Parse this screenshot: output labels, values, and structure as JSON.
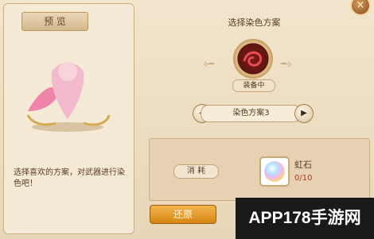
{
  "preview": {
    "tab_label": "预 览",
    "description": "选择喜欢的方案，对武器进行染色吧！"
  },
  "dye": {
    "title": "选择染色方案",
    "status_badge": "装备中",
    "current_scheme": "染色方案3",
    "prev_icon": "◀",
    "next_icon": "▶"
  },
  "consume": {
    "label": "消 耗",
    "item_name": "虹石",
    "item_count": "0/10"
  },
  "actions": {
    "restore_label": "还原",
    "close_icon": "×"
  },
  "watermark": {
    "text": "APP178手游网"
  }
}
